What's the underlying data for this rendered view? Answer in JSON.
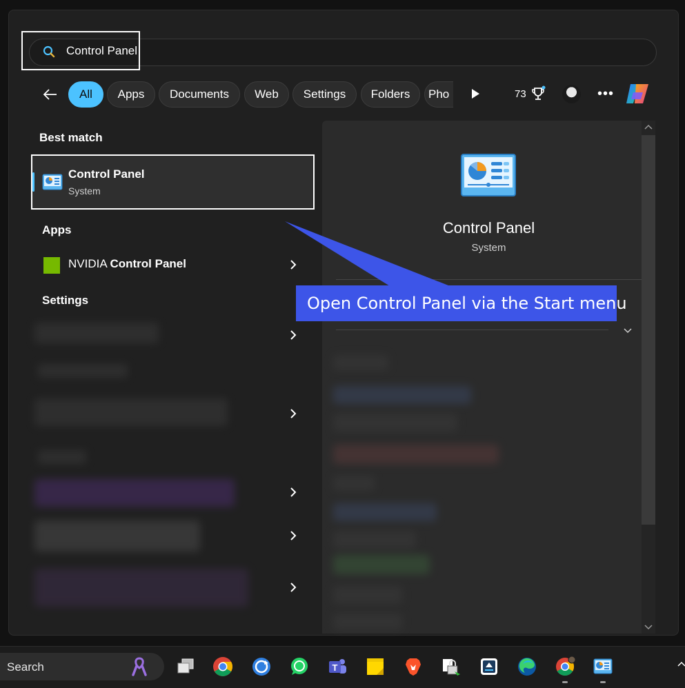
{
  "search": {
    "query": "Control Panel"
  },
  "filters": {
    "tabs": [
      {
        "label": "All",
        "active": true
      },
      {
        "label": "Apps"
      },
      {
        "label": "Documents"
      },
      {
        "label": "Web"
      },
      {
        "label": "Settings"
      },
      {
        "label": "Folders"
      },
      {
        "label": "Pho"
      }
    ],
    "rewards_points": "73"
  },
  "results": {
    "best_match_heading": "Best match",
    "best_match": {
      "title": "Control Panel",
      "subtitle": "System"
    },
    "apps_heading": "Apps",
    "apps": [
      {
        "label_prefix": "NVIDIA ",
        "label_bold": "Control Panel"
      }
    ],
    "settings_heading": "Settings"
  },
  "preview": {
    "title": "Control Panel",
    "subtitle": "System"
  },
  "callout": {
    "text": "Open Control Panel via the Start menu"
  },
  "taskbar": {
    "search_label": "Search",
    "icons": [
      "task-view-icon",
      "chrome-icon",
      "sync-app-icon",
      "whatsapp-icon",
      "teams-icon",
      "sticky-notes-icon",
      "brave-icon",
      "file-lock-icon",
      "installer-icon",
      "edge-icon",
      "chrome-profile-icon",
      "control-panel-icon"
    ]
  },
  "colors": {
    "accent": "#4cc2ff",
    "callout": "#3d55e8",
    "nvidia": "#76b900"
  }
}
